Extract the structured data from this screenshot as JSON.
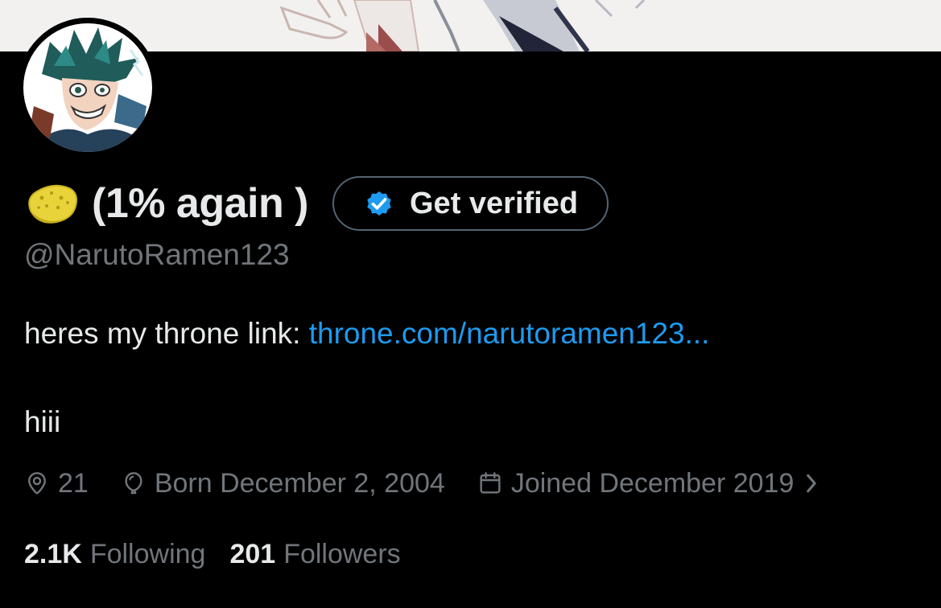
{
  "profile": {
    "display_name": "(1% again )",
    "name_emoji_icon": "sponge-icon",
    "get_verified_label": "Get verified",
    "handle": "@NarutoRamen123",
    "bio": {
      "prefix": "heres my throne link: ",
      "link_text": "throne.com/narutoramen123...",
      "second_line": "hiii"
    },
    "meta": {
      "location": "21",
      "birthday": "Born December 2, 2004",
      "joined": "Joined December 2019"
    },
    "stats": {
      "following_count": "2.1K",
      "following_label": "Following",
      "followers_count": "201",
      "followers_label": "Followers"
    }
  },
  "colors": {
    "background": "#000000",
    "primary_text": "#e7e9ea",
    "secondary_text": "#71767b",
    "link": "#1d9bf0",
    "verified_badge": "#1d9bf0",
    "button_border": "#536471"
  }
}
